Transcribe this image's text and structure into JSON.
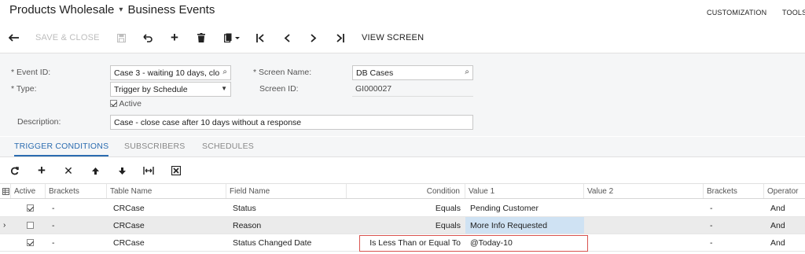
{
  "header": {
    "site": "Products Wholesale",
    "page": "Business Events",
    "customization": "CUSTOMIZATION",
    "tools": "TOOLS"
  },
  "toolbar": {
    "save_close": "SAVE & CLOSE",
    "view_screen": "VIEW SCREEN"
  },
  "form": {
    "event_id_label": "Event ID:",
    "event_id_value": "Case 3 - waiting 10 days, clo",
    "type_label": "Type:",
    "type_value": "Trigger by Schedule",
    "active_label": "Active",
    "screen_name_label": "Screen Name:",
    "screen_name_value": "DB Cases",
    "screen_id_label": "Screen ID:",
    "screen_id_value": "GI000027",
    "description_label": "Description:",
    "description_value": "Case - close case after 10 days without a response"
  },
  "tabs": [
    "TRIGGER CONDITIONS",
    "SUBSCRIBERS",
    "SCHEDULES"
  ],
  "grid": {
    "columns": [
      "Active",
      "Brackets",
      "Table Name",
      "Field Name",
      "Condition",
      "Value 1",
      "Value 2",
      "Brackets",
      "Operator"
    ],
    "rows": [
      {
        "active": true,
        "brackets": "-",
        "table": "CRCase",
        "field": "Status",
        "condition": "Equals",
        "value1": "Pending Customer",
        "value2": "",
        "brackets2": "-",
        "operator": "And"
      },
      {
        "active": false,
        "brackets": "-",
        "table": "CRCase",
        "field": "Reason",
        "condition": "Equals",
        "value1": "More Info Requested",
        "value2": "",
        "brackets2": "-",
        "operator": "And"
      },
      {
        "active": true,
        "brackets": "-",
        "table": "CRCase",
        "field": "Status Changed Date",
        "condition": "Is Less Than or Equal To",
        "value1": "@Today-10",
        "value2": "",
        "brackets2": "-",
        "operator": "And"
      }
    ]
  },
  "colors": {
    "accent": "#2b6cb0",
    "highlight": "#cfe2f3",
    "callout": "#d9534f"
  }
}
